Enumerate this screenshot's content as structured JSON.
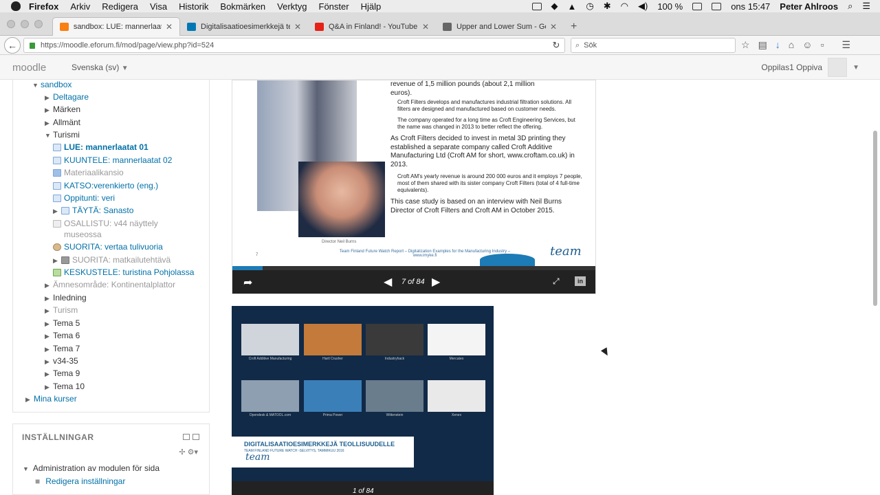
{
  "menubar": {
    "app": "Firefox",
    "items": [
      "Arkiv",
      "Redigera",
      "Visa",
      "Historik",
      "Bokmärken",
      "Verktyg",
      "Fönster",
      "Hjälp"
    ],
    "battery": "100 %",
    "clock": "ons 15:47",
    "user": "Peter Ahlroos"
  },
  "tabs": [
    {
      "label": "sandbox: LUE: mannerlaata...",
      "favicon_color": "#f98012"
    },
    {
      "label": "Digitalisaatioesimerkkejä te...",
      "favicon_color": "#0077b5"
    },
    {
      "label": "Q&A in Finland! - YouTube",
      "favicon_color": "#e62117"
    },
    {
      "label": "Upper and Lower Sum - Ge...",
      "favicon_color": "#666666"
    }
  ],
  "urlbar": {
    "url": "https://moodle.eforum.fi/mod/page/view.php?id=524",
    "search_placeholder": "Sök"
  },
  "moodle": {
    "logo": "moodle",
    "language": "Svenska (sv)",
    "user": "Oppilas1 Oppiva"
  },
  "nav": {
    "sandbox": "sandbox",
    "deltagare": "Deltagare",
    "marken": "Märken",
    "allmant": "Allmänt",
    "turismi": "Turismi",
    "lue": "LUE: mannerlaatat 01",
    "kuuntele": "KUUNTELE: mannerlaatat 02",
    "materiaali": "Materiaalikansio",
    "katso": "KATSO:verenkierto (eng.)",
    "oppitunti": "Oppitunti: veri",
    "tayta": "TÄYTÄ: Sanasto",
    "osallistu_1": "OSALLISTU: v44 näyttely",
    "osallistu_2": "museossa",
    "suorita_1": "SUORITA: vertaa tulivuoria",
    "suorita_2": "SUORITA: matkailutehtävä",
    "keskustele": "KESKUSTELE: turistina Pohjolassa",
    "amnesomrade": "Ämnesområde: Kontinentalplattor",
    "inledning": "Inledning",
    "turism": "Turism",
    "tema5": "Tema 5",
    "tema6": "Tema 6",
    "tema7": "Tema 7",
    "v34": "v34-35",
    "tema9": "Tema 9",
    "tema10": "Tema 10",
    "minakurser": "Mina kurser"
  },
  "settings": {
    "title": "INSTÄLLNINGAR",
    "admin": "Administration av modulen för sida",
    "edit": "Redigera inställningar"
  },
  "slide1": {
    "line0": "revenue of 1,5 million pounds (about 2,1 million",
    "line0b": "euros).",
    "b1": "Croft Filters develops and manufactures industrial filtration solutions. All filters are designed and manufactured based on customer needs.",
    "b2": "The company operated for a long time as Croft Engineering Services, but the name was changed in 2013 to better reflect the offering.",
    "b3": "As Croft Filters decided to invest in metal 3D printing they established a separate company called Croft Additive Manufacturing Ltd (Croft AM for short, www.croftam.co.uk) in 2013.",
    "b4": "Croft AM's yearly revenue is around 200 000 euros and it employs 7 people, most of them shared with its sister company Croft Filters (total of 4 full-time equivalents).",
    "b5": "This case study is based on an interview with Neil Burns Director of Croft Filters and Croft AM in October 2015.",
    "caption": "Director Neil Burns",
    "footer": "Team Finland Future Watch Report – Digitalization Examples for the Manufacturing Industry – www.imyke.fi",
    "logo": "team",
    "pagenum": "7",
    "page_indicator": "7 of 84",
    "progress": 0.083
  },
  "slide2": {
    "thumbs": [
      {
        "label": "Croft Additive Manufacturing",
        "color": "#cfd5db"
      },
      {
        "label": "Hartl Crusher",
        "color": "#c47a3a"
      },
      {
        "label": "Industryhack",
        "color": "#3a3a3a"
      },
      {
        "label": "Mercateo",
        "color": "#f4f4f4"
      },
      {
        "label": "Opendesk & MATOOL.com",
        "color": "#8d9fb0"
      },
      {
        "label": "Prima Power",
        "color": "#3b7fb8"
      },
      {
        "label": "Wittenstein",
        "color": "#6a7d8d"
      },
      {
        "label": "Xenex",
        "color": "#e9e9e9"
      }
    ],
    "title": "DIGITALISAATIOESIMERKKEJÄ TEOLLISUUDELLE",
    "subtitle": "TEAM FINLAND FUTURE WATCH -SELVITYS, TAMMIKUU 2016",
    "logo": "team",
    "page_indicator": "1 of 84"
  }
}
